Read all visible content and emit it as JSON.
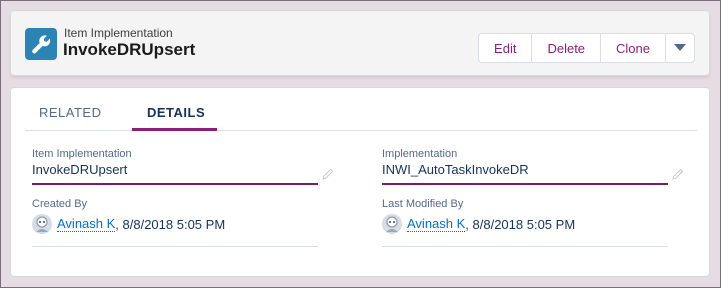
{
  "header": {
    "object_type": "Item Implementation",
    "record_name": "InvokeDRUpsert",
    "icon": "wrench-icon",
    "buttons": {
      "edit": "Edit",
      "delete": "Delete",
      "clone": "Clone"
    }
  },
  "tabs": [
    {
      "label": "RELATED"
    },
    {
      "label": "DETAILS",
      "active": true
    }
  ],
  "fields": {
    "item_implementation": {
      "label": "Item Implementation",
      "value": "InvokeDRUpsert"
    },
    "implementation": {
      "label": "Implementation",
      "value": "INWI_AutoTaskInvokeDR"
    },
    "created_by": {
      "label": "Created By",
      "user": "Avinash K",
      "date": ", 8/8/2018 5:05 PM"
    },
    "last_modified_by": {
      "label": "Last Modified By",
      "user": "Avinash K",
      "date": ", 8/8/2018 5:05 PM"
    }
  },
  "colors": {
    "accent": "#8b1f74",
    "link": "#0070d2",
    "icon_bg": "#2c84b5"
  }
}
